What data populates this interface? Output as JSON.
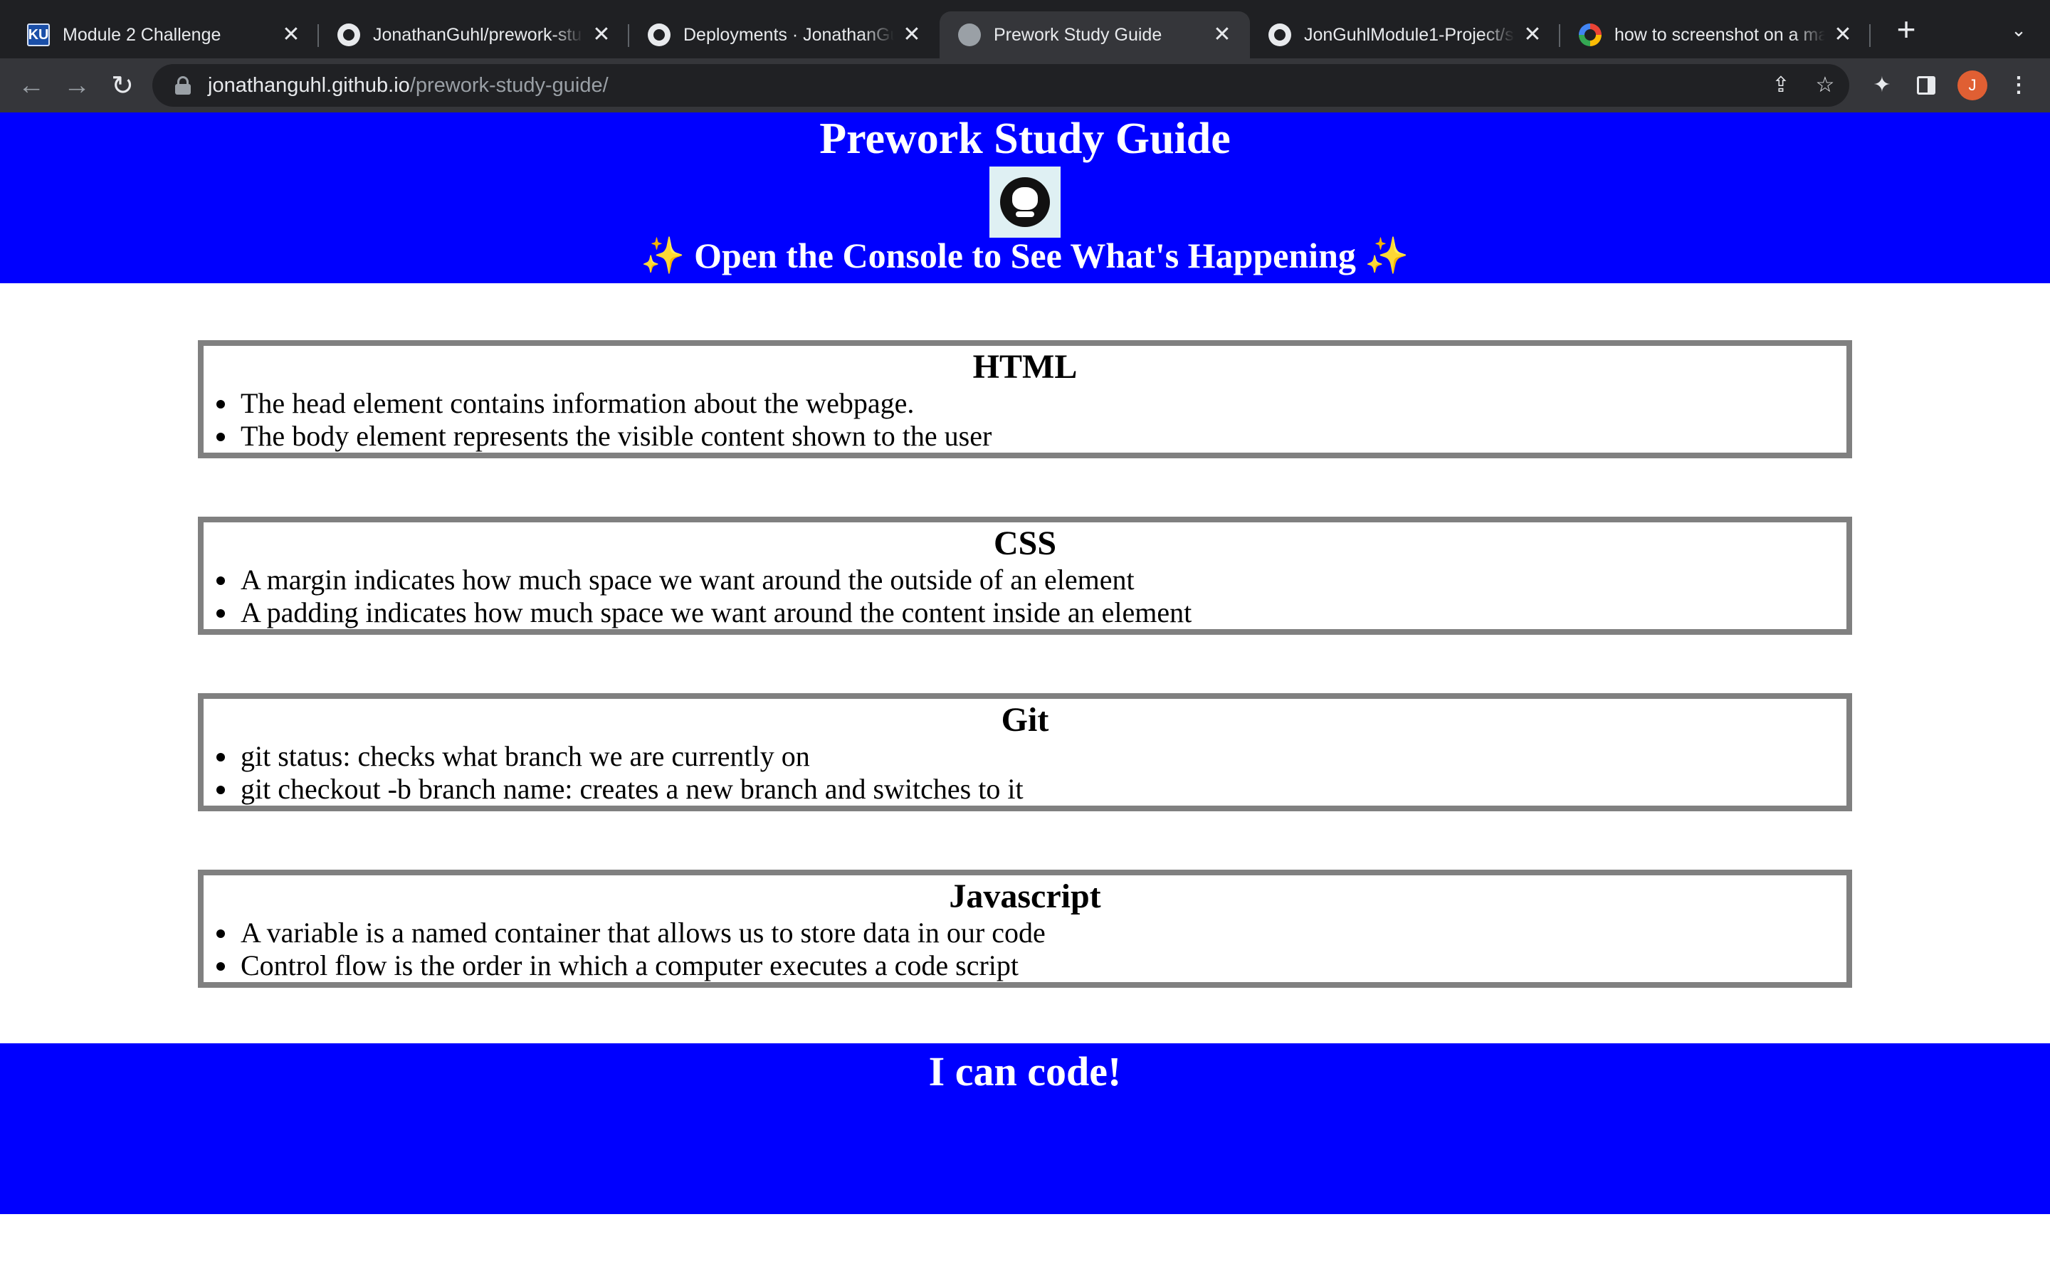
{
  "browser": {
    "tabs": [
      {
        "title": "Module 2 Challenge",
        "favicon": "ku-icon"
      },
      {
        "title": "JonathanGuhl/prework-stu",
        "favicon": "github-icon"
      },
      {
        "title": "Deployments · JonathanGu",
        "favicon": "github-icon"
      },
      {
        "title": "Prework Study Guide",
        "favicon": "globe-icon",
        "active": true
      },
      {
        "title": "JonGuhlModule1-Project/st",
        "favicon": "github-icon"
      },
      {
        "title": "how to screenshot on a ma",
        "favicon": "google-icon"
      }
    ],
    "close_glyph": "✕",
    "new_tab_glyph": "+",
    "url_host": "jonathanguhl.github.io",
    "url_path": "/prework-study-guide/",
    "avatar_letter": "J",
    "avatar_color": "#e05f33"
  },
  "header": {
    "title": "Prework Study Guide",
    "subtitle_text": "Open the Console to See What's Happening",
    "sparkle": "✨",
    "background": "#0000ff"
  },
  "sections": [
    {
      "heading": "HTML",
      "items": [
        "The head element contains information about the webpage.",
        "The body element represents the visible content shown to the user"
      ]
    },
    {
      "heading": "CSS",
      "items": [
        "A margin indicates how much space we want around the outside of an element",
        "A padding indicates how much space we want around the content inside an element"
      ]
    },
    {
      "heading": "Git",
      "items": [
        "git status: checks what branch we are currently on",
        "git checkout -b branch name: creates a new branch and switches to it"
      ]
    },
    {
      "heading": "Javascript",
      "items": [
        "A variable is a named container that allows us to store data in our code",
        "Control flow is the order in which a computer executes a code script"
      ]
    }
  ],
  "footer": {
    "text": "I can code!"
  }
}
